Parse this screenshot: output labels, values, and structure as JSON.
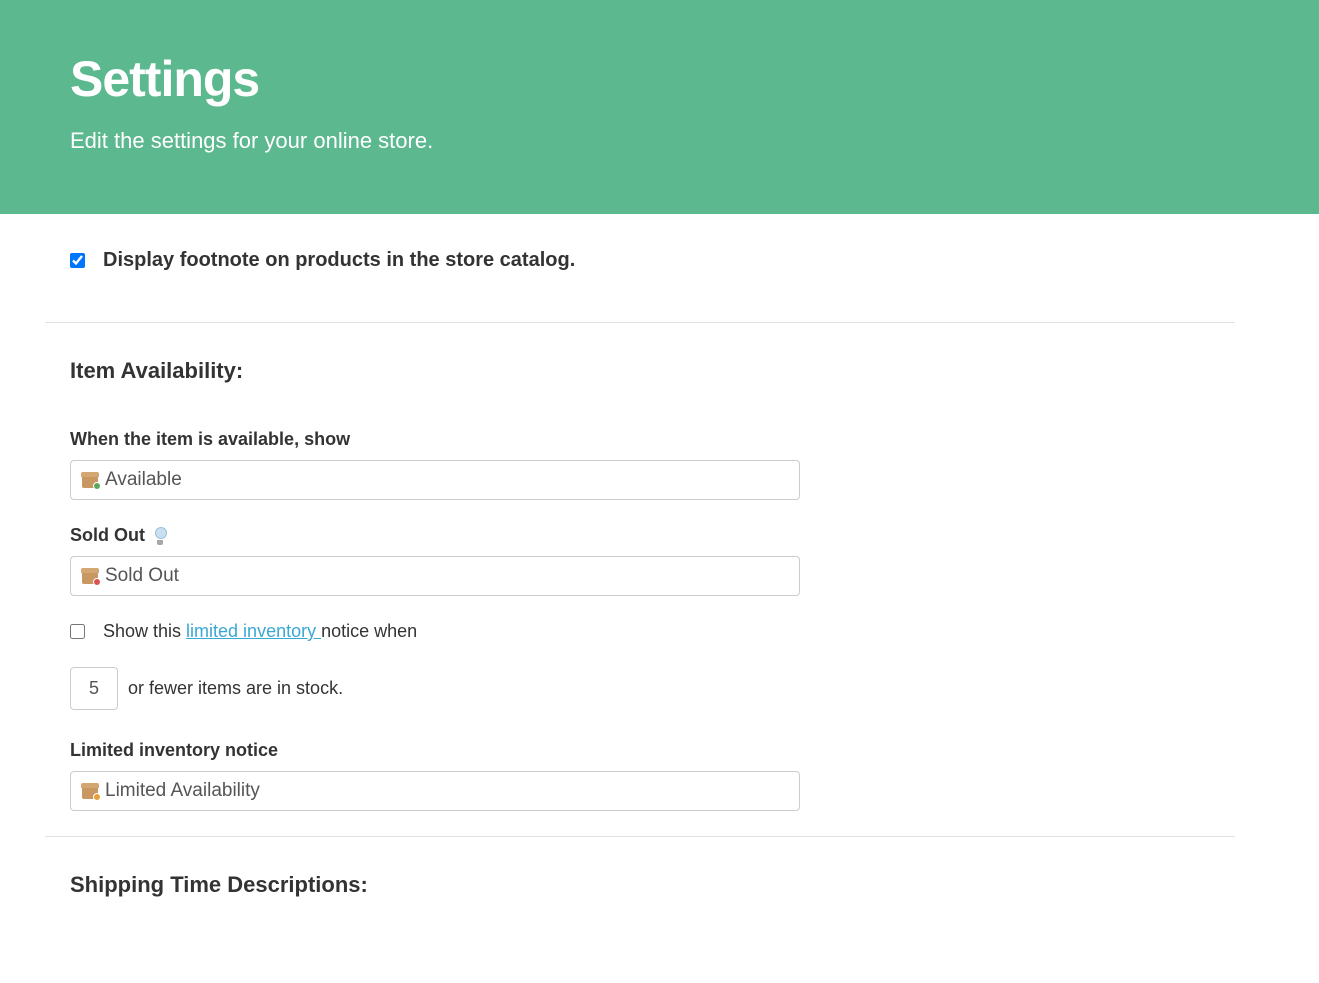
{
  "header": {
    "title": "Settings",
    "subtitle": "Edit the settings for your online store."
  },
  "footnote": {
    "checked": true,
    "label": "Display footnote on products in the store catalog."
  },
  "item_availability": {
    "section_title": "Item Availability:",
    "available": {
      "label": "When the item is available, show",
      "value": "Available"
    },
    "sold_out": {
      "label": "Sold Out",
      "value": "Sold Out"
    },
    "limited_inventory": {
      "show_checkbox_checked": false,
      "show_prefix": "Show this ",
      "link_text": "limited inventory ",
      "show_suffix": "notice when",
      "threshold": "5",
      "threshold_suffix": "or fewer items are in stock.",
      "notice_label": "Limited inventory notice",
      "notice_value": "Limited Availability"
    }
  },
  "shipping": {
    "section_title": "Shipping Time Descriptions:"
  }
}
